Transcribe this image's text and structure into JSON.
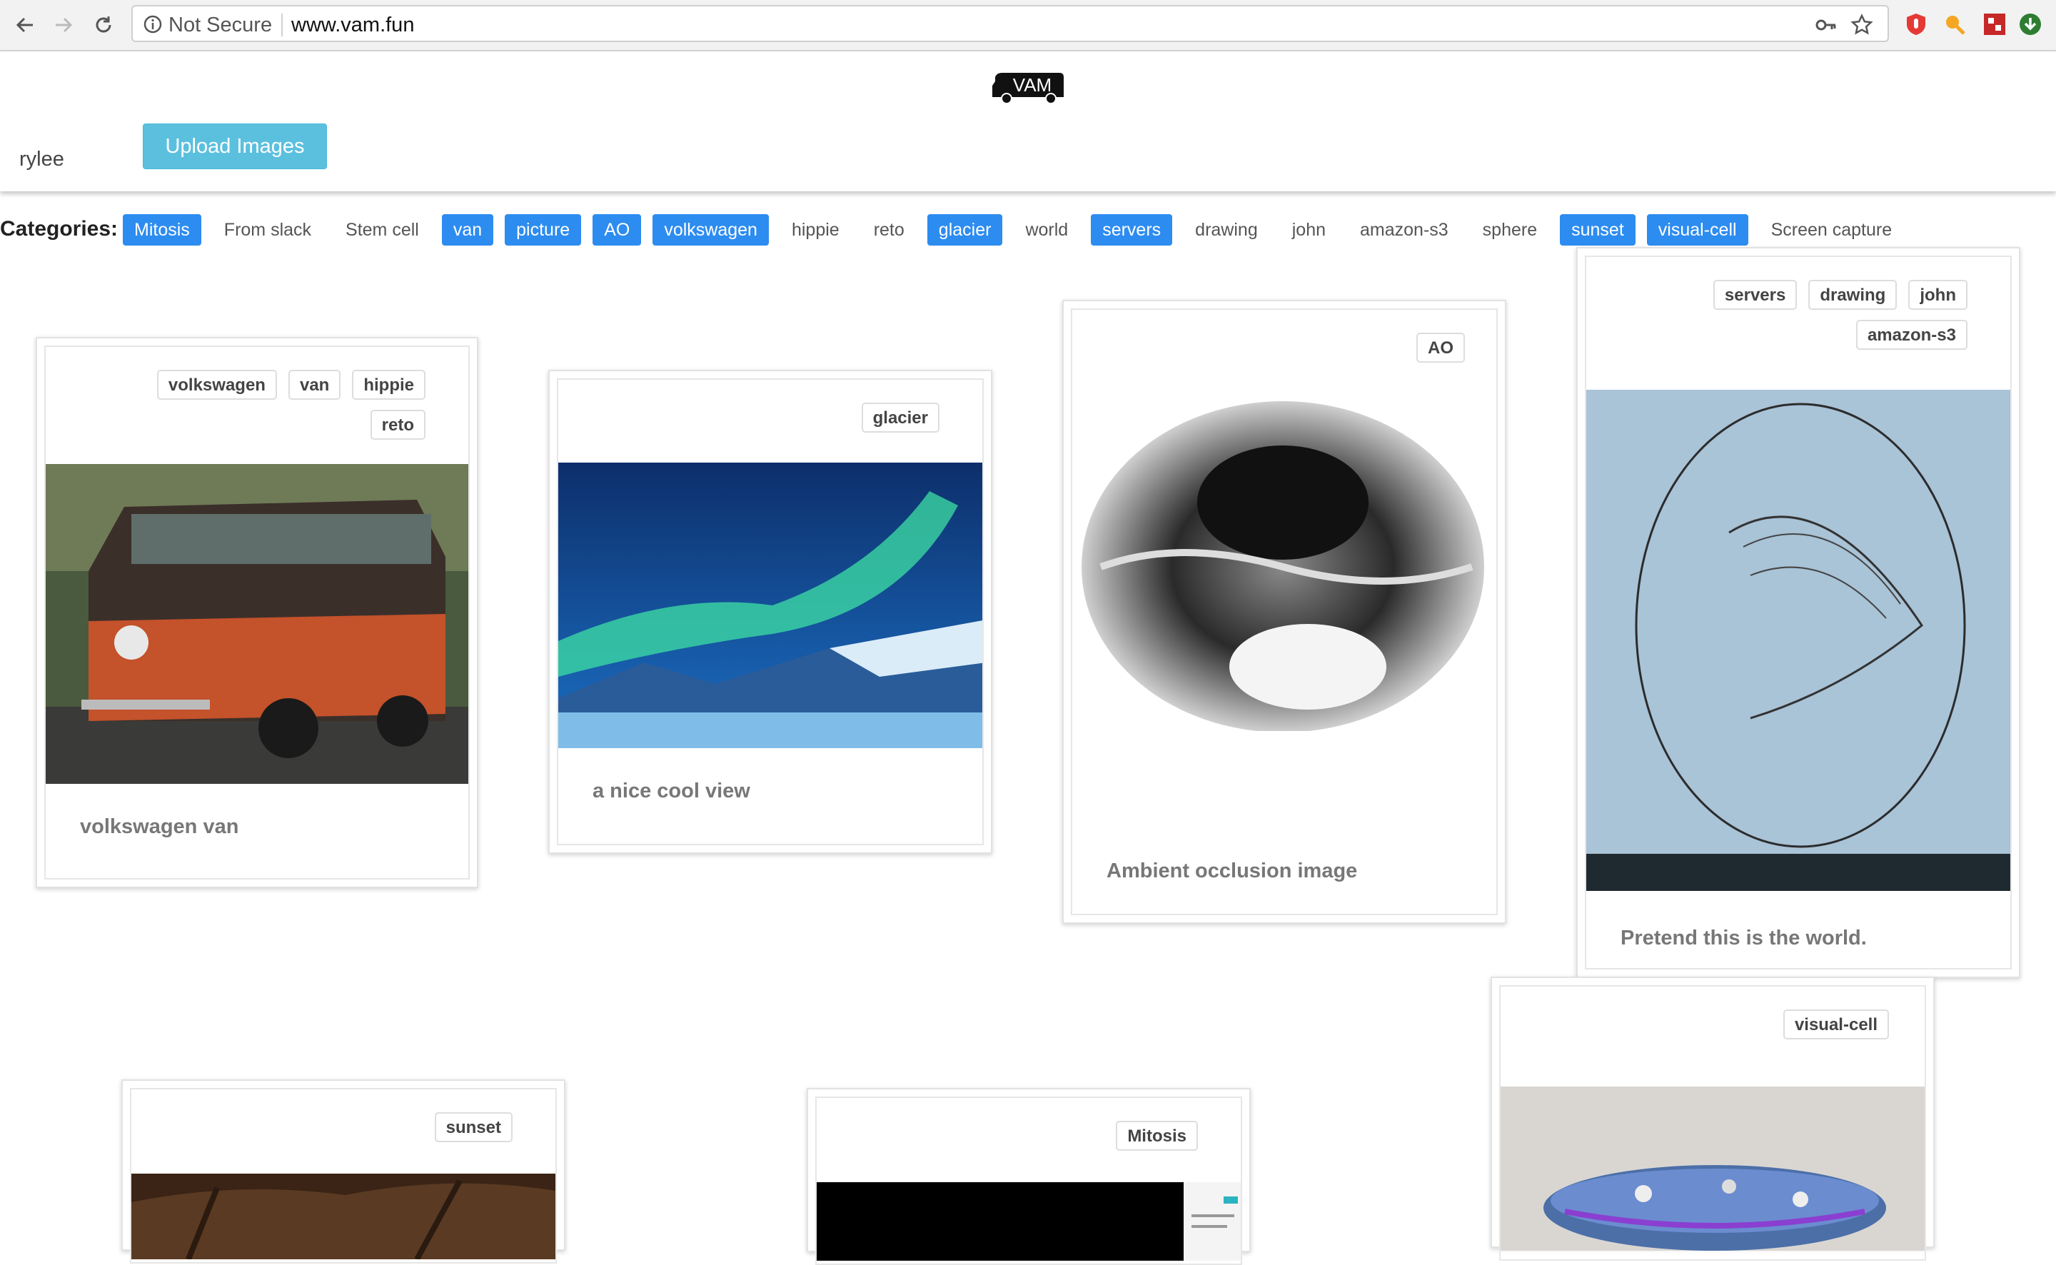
{
  "browser": {
    "security_label": "Not Secure",
    "url": "www.vam.fun"
  },
  "header": {
    "logo_text": "VAM",
    "username": "rylee",
    "upload_label": "Upload Images"
  },
  "categories": {
    "label": "Categories:",
    "items": [
      {
        "label": "Mitosis",
        "active": true
      },
      {
        "label": "From slack",
        "active": false
      },
      {
        "label": "Stem cell",
        "active": false
      },
      {
        "label": "van",
        "active": true
      },
      {
        "label": "picture",
        "active": true
      },
      {
        "label": "AO",
        "active": true
      },
      {
        "label": "volkswagen",
        "active": true
      },
      {
        "label": "hippie",
        "active": false
      },
      {
        "label": "reto",
        "active": false
      },
      {
        "label": "glacier",
        "active": true
      },
      {
        "label": "world",
        "active": false
      },
      {
        "label": "servers",
        "active": true
      },
      {
        "label": "drawing",
        "active": false
      },
      {
        "label": "john",
        "active": false
      },
      {
        "label": "amazon-s3",
        "active": false
      },
      {
        "label": "sphere",
        "active": false
      },
      {
        "label": "sunset",
        "active": true
      },
      {
        "label": "visual-cell",
        "active": true
      },
      {
        "label": "Screen capture",
        "active": false
      }
    ]
  },
  "cards": [
    {
      "tags": [
        "volkswagen",
        "van",
        "hippie",
        "reto"
      ],
      "caption": "volkswagen van",
      "image": "orange-vw-van-photo"
    },
    {
      "tags": [
        "glacier"
      ],
      "caption": "a nice cool view",
      "image": "aurora-glacier-photo"
    },
    {
      "tags": [
        "AO"
      ],
      "caption": "Ambient occlusion image",
      "image": "ambient-occlusion-sphere"
    },
    {
      "tags": [
        "servers",
        "drawing",
        "john",
        "amazon-s3"
      ],
      "caption": "Pretend this is the world.",
      "image": "projected-sketch-photo"
    },
    {
      "tags": [
        "sunset"
      ],
      "caption": "",
      "image": "sunset-trees-photo"
    },
    {
      "tags": [
        "Mitosis"
      ],
      "caption": "",
      "image": "screen-capture-dark"
    },
    {
      "tags": [
        "visual-cell"
      ],
      "caption": "",
      "image": "cell-3d-render"
    }
  ]
}
